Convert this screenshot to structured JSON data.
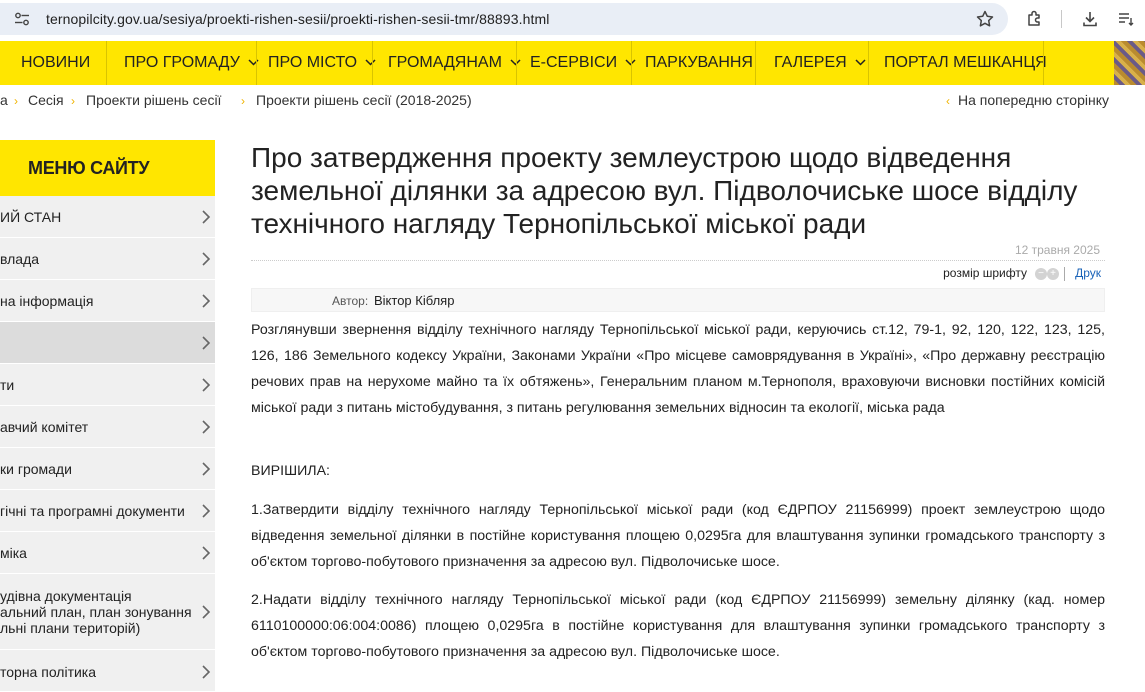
{
  "browser": {
    "url": "ternopilcity.gov.ua/sesiya/proekti-rishen-sesii/proekti-rishen-sesii-tmr/88893.html"
  },
  "nav": {
    "items": [
      {
        "label": "НОВИНИ"
      },
      {
        "label": "ПРО ГРОМАДУ"
      },
      {
        "label": "ПРО МІСТО"
      },
      {
        "label": "ГРОМАДЯНАМ"
      },
      {
        "label": "Е-СЕРВІСИ"
      },
      {
        "label": "ПАРКУВАННЯ"
      },
      {
        "label": "ГАЛЕРЕЯ"
      },
      {
        "label": "ПОРТАЛ МЕШКАНЦЯ"
      }
    ]
  },
  "breadcrumb": {
    "items": [
      "а",
      "Сесія",
      "Проекти рішень сесії",
      "Проекти рішень сесії (2018-2025)"
    ],
    "back_label": "На попередню сторінку"
  },
  "sidebar": {
    "heading": "МЕНЮ САЙТУ",
    "items": [
      {
        "label": "ИЙ СТАН"
      },
      {
        "label": "влада"
      },
      {
        "label": "на інформація"
      },
      {
        "label": ""
      },
      {
        "label": "ти"
      },
      {
        "label": "авчий комітет"
      },
      {
        "label": "ки громади"
      },
      {
        "label": "гічні та програмні документи"
      },
      {
        "label": "міка"
      },
      {
        "label_lines": [
          "удівна документація",
          "альний план, план зонування",
          "льні плани територій)"
        ]
      },
      {
        "label": "торна політика"
      }
    ]
  },
  "article": {
    "title": "Про затвердження проекту землеустрою щодо відведення земельної ділянки за адресою вул. Підволочиське шосе відділу технічного нагляду Тернопільської міської ради",
    "date": "12 травня 2025",
    "font_size_label": "розмір шрифту",
    "print_label": "Друк",
    "author_label": "Автор:",
    "author_name": "Віктор Кібляр",
    "paragraphs": [
      "Розглянувши звернення відділу технічного нагляду Тернопільської міської ради, керуючись ст.12, 79-1, 92, 120, 122, 123, 125, 126, 186 Земельного кодексу України, Законами України «Про місцеве самоврядування в Україні», «Про державну реєстрацію речових прав на нерухоме майно та їх обтяжень», Генеральним планом м.Тернополя, враховуючи висновки постійних комісій міської ради з питань містобудування, з питань регулювання земельних відносин та екології, міська рада",
      "ВИРІШИЛА:",
      "1.Затвердити відділу технічного нагляду Тернопільської міської ради (код ЄДРПОУ 21156999) проект землеустрою щодо відведення земельної ділянки в постійне користування площею 0,0295га для влаштування зупинки громадського транспорту з об'єктом торгово-побутового призначення за адресою вул. Підволочиське шосе.",
      "2.Надати відділу технічного нагляду Тернопільської міської ради (код ЄДРПОУ 21156999) земельну ділянку (кад. номер 6110100000:06:004:0086) площею 0,0295га в постійне користування для влаштування зупинки громадського транспорту з об'єктом торгово-побутового призначення за адресою вул. Підволочиське шосе."
    ]
  },
  "colors": {
    "brand_yellow": "#ffe600",
    "link_blue": "#1a63b8"
  },
  "icons": [
    "site-info-icon",
    "bookmark-star-icon",
    "extensions-icon",
    "download-icon",
    "menu-icon",
    "chevron-down-icon",
    "chevron-right-icon"
  ]
}
